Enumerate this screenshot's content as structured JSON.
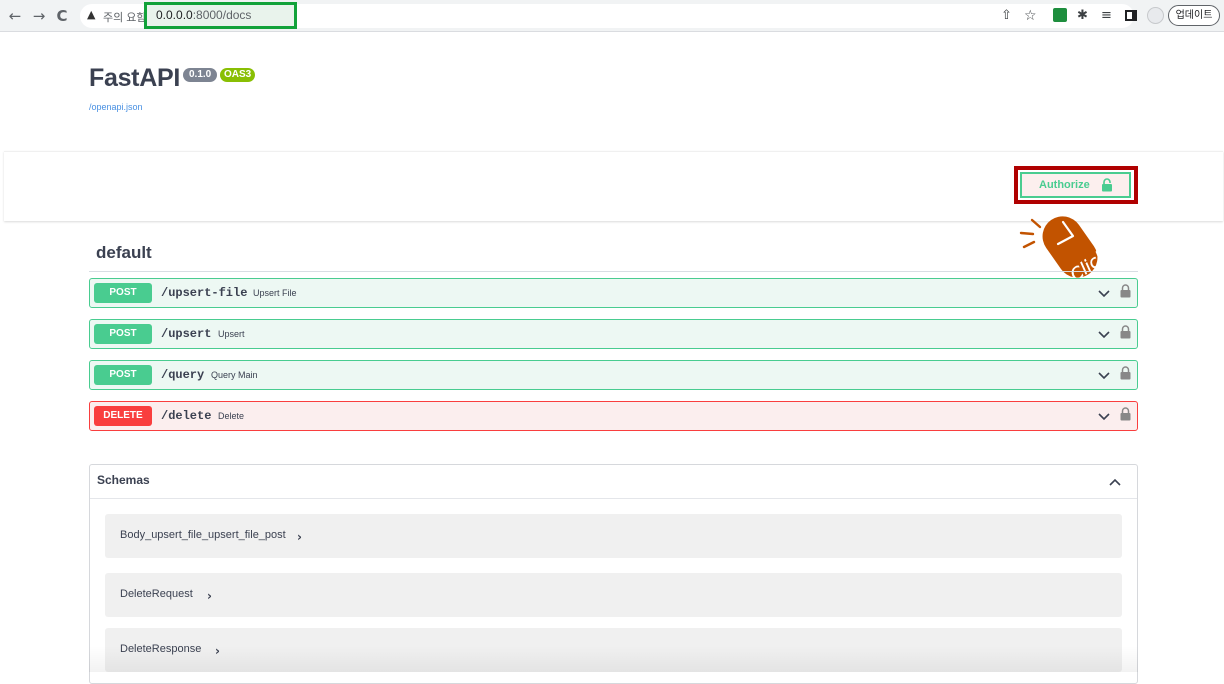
{
  "browser": {
    "back_glyph": "←",
    "forward_glyph": "→",
    "reload_glyph": "C",
    "warning_glyph": "▲",
    "warning_text": "주의 요함",
    "url_host": "0.0.0.0",
    "url_path": ":8000/docs",
    "share_glyph": "⇧",
    "star_glyph": "☆",
    "puzzle_glyph": "✱",
    "queue_glyph": "≡",
    "update_label": "업데이트",
    "more_glyph": "⋮"
  },
  "info": {
    "title": "FastAPI",
    "version": "0.1.0",
    "oas": "OAS3",
    "spec_link": "/openapi.json"
  },
  "authorize": {
    "label": "Authorize",
    "icon": "lock-icon"
  },
  "annotation": {
    "text": "Click",
    "color": "#c25300",
    "icon": "pointer-icon"
  },
  "section": {
    "title": "default"
  },
  "operations": [
    {
      "method": "POST",
      "path": "/upsert-file",
      "summary": "Upsert File"
    },
    {
      "method": "POST",
      "path": "/upsert",
      "summary": "Upsert"
    },
    {
      "method": "POST",
      "path": "/query",
      "summary": "Query Main"
    },
    {
      "method": "DELETE",
      "path": "/delete",
      "summary": "Delete"
    }
  ],
  "schemas": {
    "title": "Schemas",
    "models": [
      {
        "name": "Body_upsert_file_upsert_file_post",
        "arrow": "›"
      },
      {
        "name": "DeleteRequest",
        "arrow": "›"
      },
      {
        "name": "DeleteResponse",
        "arrow": "›"
      }
    ]
  },
  "colors": {
    "post": "#49cc90",
    "delete": "#f93e3e",
    "url_highlight": "#12a23a",
    "auth_highlight": "#b00000"
  }
}
